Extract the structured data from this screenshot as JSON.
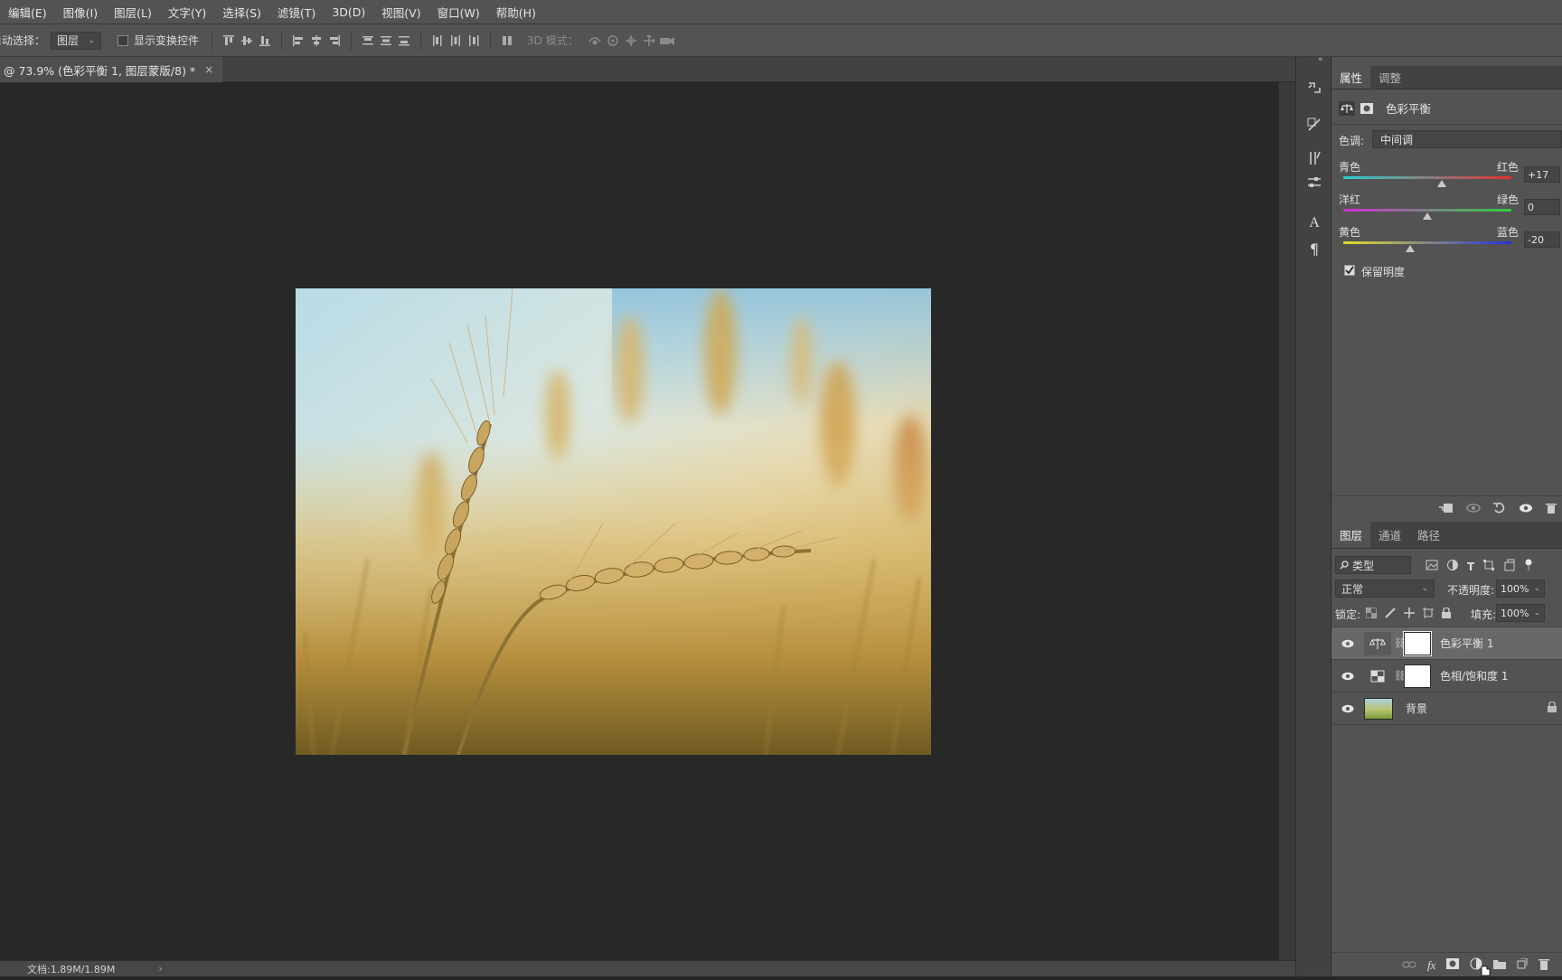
{
  "menu": [
    "编辑(E)",
    "图像(I)",
    "图层(L)",
    "文字(Y)",
    "选择(S)",
    "滤镜(T)",
    "3D(D)",
    "视图(V)",
    "窗口(W)",
    "帮助(H)"
  ],
  "options": {
    "auto_select_label": "自动选择：",
    "auto_select_value": "图层",
    "show_transform_label": "显示变换控件",
    "mode_3d_label": "3D 模式："
  },
  "document": {
    "tab_title": "@ 73.9% (色彩平衡 1, 图层蒙版/8) *",
    "close_glyph": "×"
  },
  "status": {
    "doc_size": "文档:1.89M/1.89M",
    "arrow": "›"
  },
  "properties": {
    "tabs": [
      "属性",
      "调整"
    ],
    "title": "色彩平衡",
    "tone_label": "色调:",
    "tone_value": "中间调",
    "sliders": [
      {
        "left": "青色",
        "right": "红色",
        "value": "+17",
        "level": 17
      },
      {
        "left": "洋红",
        "right": "绿色",
        "value": "0",
        "level": 0
      },
      {
        "left": "黄色",
        "right": "蓝色",
        "value": "-20",
        "level": -20
      }
    ],
    "preserve_luminosity": "保留明度",
    "preserve_checked": true
  },
  "layers": {
    "tabs": [
      "图层",
      "通道",
      "路径"
    ],
    "filter_kind": "类型",
    "blend_mode": "正常",
    "opacity_label": "不透明度:",
    "opacity_value": "100%",
    "lock_label": "锁定:",
    "fill_label": "填充:",
    "fill_value": "100%",
    "items": [
      {
        "name": "色彩平衡 1",
        "type": "color-balance",
        "selected": true
      },
      {
        "name": "色相/饱和度 1",
        "type": "hue-saturation",
        "selected": false
      },
      {
        "name": "背景",
        "type": "background",
        "selected": false,
        "locked": true
      }
    ]
  },
  "colors": {
    "accent_selected_row": "#686868",
    "panel_bg": "#535353",
    "canvas_bg": "#282828"
  }
}
